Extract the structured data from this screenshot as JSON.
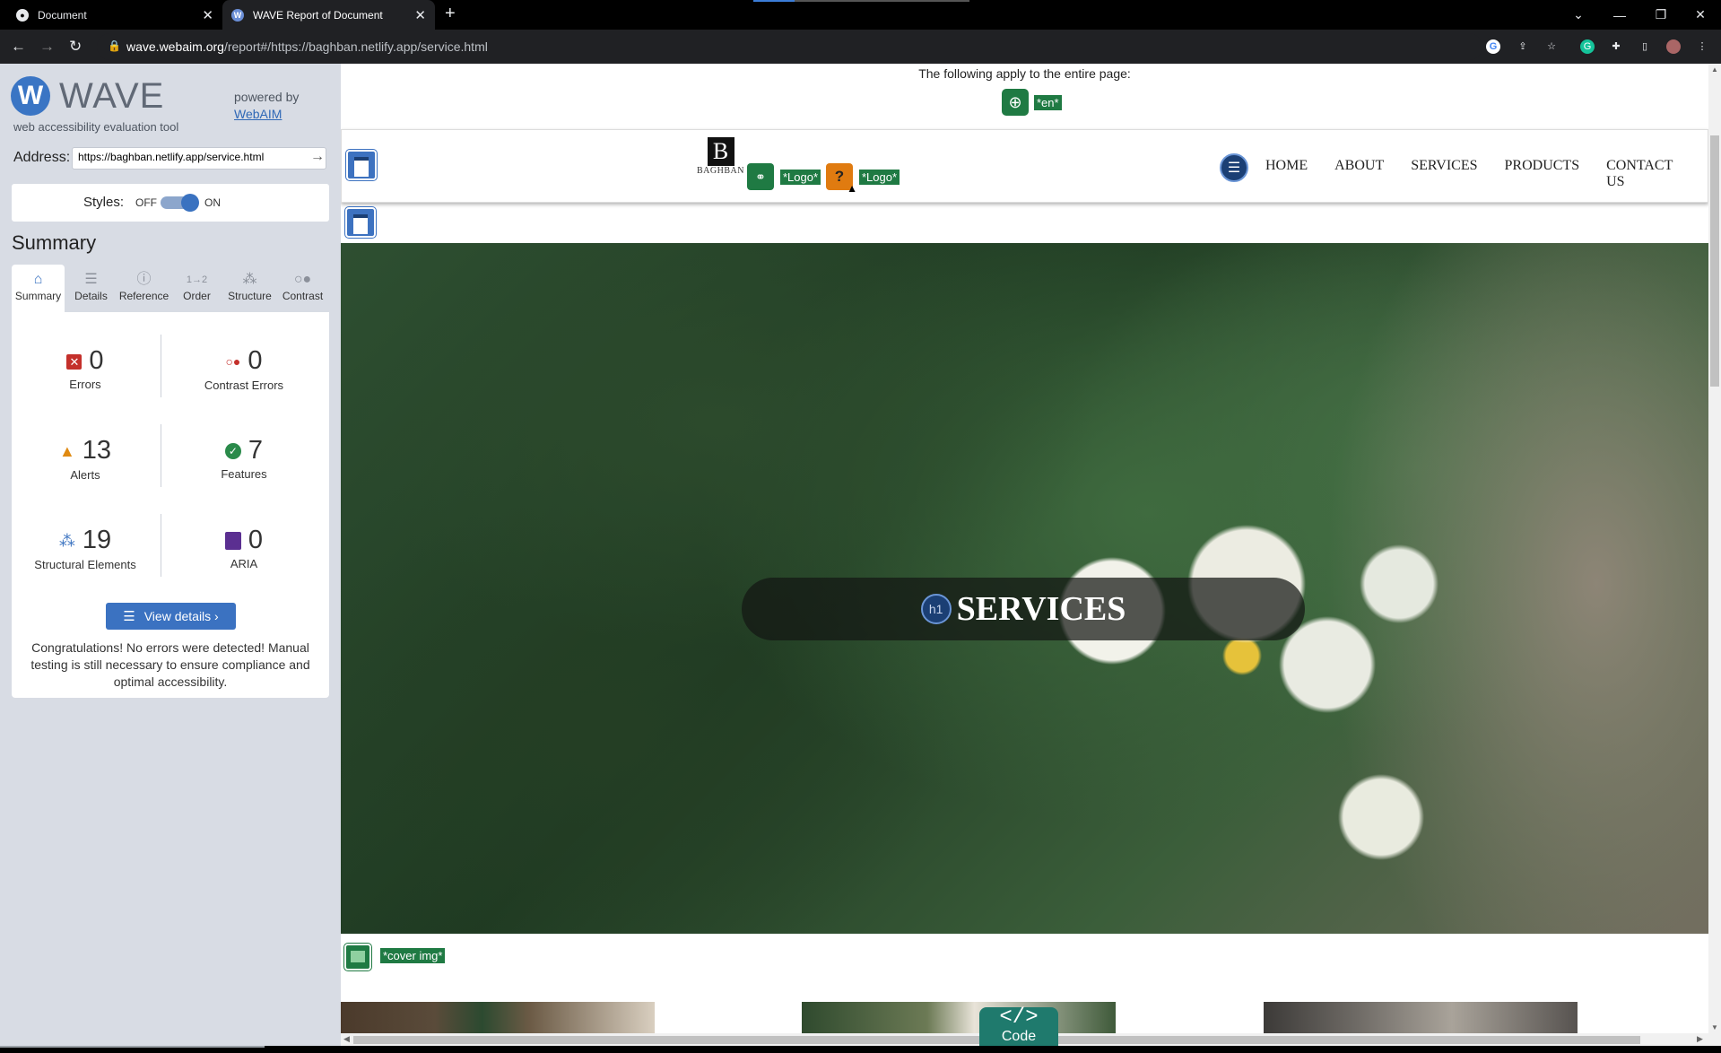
{
  "browser": {
    "tabs": [
      {
        "title": "Document",
        "active": false
      },
      {
        "title": "WAVE Report of Document",
        "active": true
      }
    ],
    "url_host": "wave.webaim.org",
    "url_path": "/report#/https://baghban.netlify.app/service.html"
  },
  "wave": {
    "title": "WAVE",
    "subtitle": "web accessibility evaluation tool",
    "powered_by": "powered by",
    "webaim_link": "WebAIM",
    "address_label": "Address:",
    "address_value": "https://baghban.netlify.app/service.html",
    "styles_label": "Styles:",
    "styles_off": "OFF",
    "styles_on": "ON",
    "summary_heading": "Summary",
    "tabs": [
      {
        "label": "Summary",
        "icon": "home-icon"
      },
      {
        "label": "Details",
        "icon": "list-icon"
      },
      {
        "label": "Reference",
        "icon": "info-icon"
      },
      {
        "label": "Order",
        "icon": "order-icon"
      },
      {
        "label": "Structure",
        "icon": "structure-icon"
      },
      {
        "label": "Contrast",
        "icon": "contrast-icon"
      }
    ],
    "stats": {
      "errors": {
        "count": "0",
        "label": "Errors",
        "color": "#c4302b"
      },
      "contrast_errors": {
        "count": "0",
        "label": "Contrast Errors",
        "color": "#c4302b"
      },
      "alerts": {
        "count": "13",
        "label": "Alerts",
        "color": "#e08a12"
      },
      "features": {
        "count": "7",
        "label": "Features",
        "color": "#2a8a4a"
      },
      "structural": {
        "count": "19",
        "label": "Structural Elements",
        "color": "#3a72c0"
      },
      "aria": {
        "count": "0",
        "label": "ARIA",
        "color": "#5b2f91"
      }
    },
    "view_details": "View details ›",
    "congrats": "Congratulations! No errors were detected! Manual testing is still necessary to ensure compliance and optimal accessibility."
  },
  "page": {
    "entire_page_note": "The following apply to the entire page:",
    "lang_tag": "*en*",
    "logo_tag_1": "*Logo*",
    "logo_tag_2": "*Logo*",
    "logo_letter": "B",
    "logo_text": "BAGHBAN",
    "nav": [
      "HOME",
      "ABOUT",
      "SERVICES",
      "PRODUCTS",
      "CONTACT US"
    ],
    "hero_title": "SERVICES",
    "h1_icon_text": "h1",
    "cover_tag": "*cover img*",
    "code_label": "Code",
    "code_icon": "</>"
  }
}
